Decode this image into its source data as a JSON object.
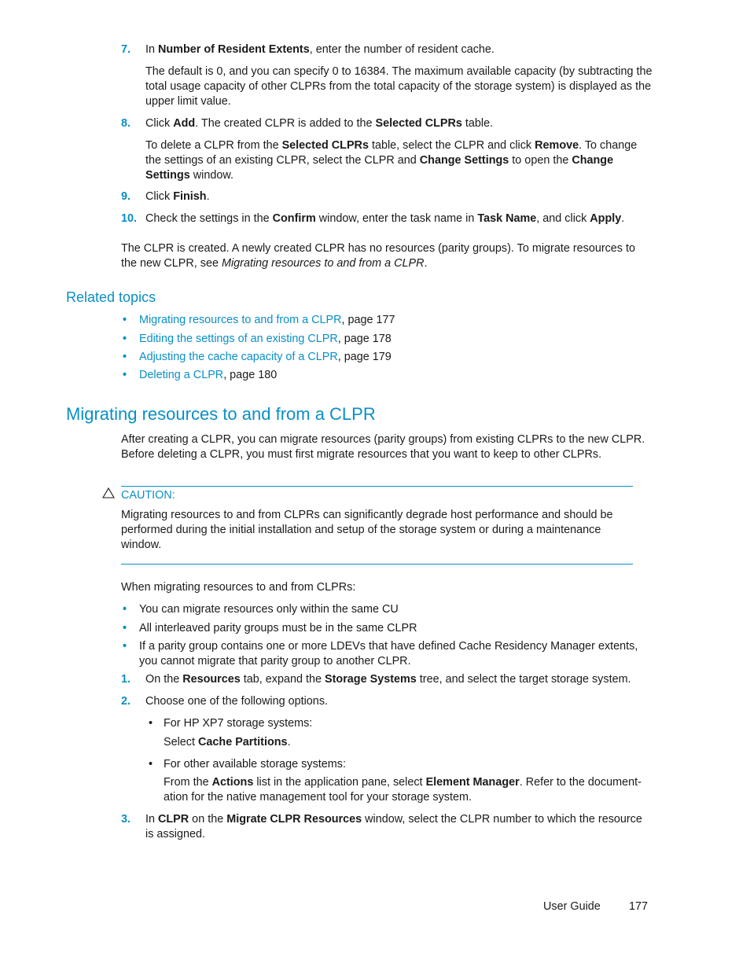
{
  "steps_top": [
    {
      "number": "7.",
      "pre": "In ",
      "bold1": "Number of Resident Extents",
      "post": ", enter the number of resident cache.",
      "detail": "The default is 0, and you can specify 0 to 16384. The maximum available capacity (by subtracting the total usage capacity of other CLPRs from the total capacity of the storage system) is displayed as the upper limit value."
    },
    {
      "number": "8.",
      "pre": "Click ",
      "bold1": "Add",
      "mid": ". The created CLPR is added to the ",
      "bold2": "Selected CLPRs",
      "post": " table.",
      "detail": {
        "t1": "To delete a CLPR from the ",
        "b1": "Selected CLPRs",
        "t2": " table, select the CLPR and click ",
        "b2": "Remove",
        "t3": ". To change the settings of an existing CLPR, select the CLPR and ",
        "b3": "Change Settings",
        "t4": " to open the ",
        "b4": "Change Settings",
        "t5": " window."
      }
    },
    {
      "number": "9.",
      "pre": "Click ",
      "bold1": "Finish",
      "post": "."
    },
    {
      "number": "10.",
      "pre": "Check the settings in the ",
      "bold1": "Confirm",
      "mid": " window, enter the task name in ",
      "bold2": "Task Name",
      "mid2": ", and click ",
      "bold3": "Apply",
      "post": "."
    }
  ],
  "result_paragraph": {
    "text": "The CLPR is created. A newly created CLPR has no resources (parity groups). To migrate resources to the new CLPR, see ",
    "italic": "Migrating resources to and from a CLPR",
    "end": "."
  },
  "related_topics": {
    "heading": "Related topics",
    "items": [
      {
        "link": "Migrating resources to and from a CLPR",
        "page": ", page 177"
      },
      {
        "link": "Editing the settings of an existing CLPR",
        "page": ", page 178"
      },
      {
        "link": "Adjusting the cache capacity of a CLPR",
        "page": ", page 179"
      },
      {
        "link": "Deleting a CLPR",
        "page": ", page 180"
      }
    ]
  },
  "section": {
    "title": "Migrating resources to and from a CLPR",
    "intro": "After creating a CLPR, you can migrate resources (parity groups) from existing CLPRs to the new CLPR. Before deleting a CLPR, you must first migrate resources that you want to keep to other CLPRs.",
    "caution": {
      "label": "CAUTION:",
      "icon": "warning-triangle-icon",
      "text": "Migrating resources to and from CLPRs can significantly degrade host performance and should be performed during the initial installation and setup of the storage system or during a maintenance window."
    },
    "lead": "When migrating resources to and from CLPRs:",
    "rules": [
      "You can migrate resources only within the same CU",
      "All interleaved parity groups must be in the same CLPR",
      "If a parity group contains one or more LDEVs that have defined Cache Residency Manager extents, you cannot migrate that parity group to another CLPR."
    ],
    "steps": [
      {
        "number": "1.",
        "t1": "On the ",
        "b1": "Resources",
        "t2": " tab, expand the ",
        "b2": "Storage Systems",
        "t3": " tree, and select the target storage system."
      },
      {
        "number": "2.",
        "text": "Choose one of the following options.",
        "options": [
          {
            "label": "For HP XP7 storage systems:",
            "d1": "Select ",
            "db1": "Cache Partitions",
            "d2": "."
          },
          {
            "label": "For other available storage systems:",
            "d1": "From the ",
            "db1": "Actions",
            "d2": " list in the application pane, select ",
            "db2": "Element Manager",
            "d3": ". Refer to the document-ation for the native management tool for your storage system."
          }
        ]
      },
      {
        "number": "3.",
        "t1": "In ",
        "b1": "CLPR",
        "t2": " on the ",
        "b2": "Migrate CLPR Resources",
        "t3": " window, select the CLPR number to which the resource is assigned."
      }
    ]
  },
  "footer": {
    "guide": "User Guide",
    "page": "177"
  },
  "colors": {
    "accent": "#0a8fc6",
    "text": "#1a1a1a"
  }
}
